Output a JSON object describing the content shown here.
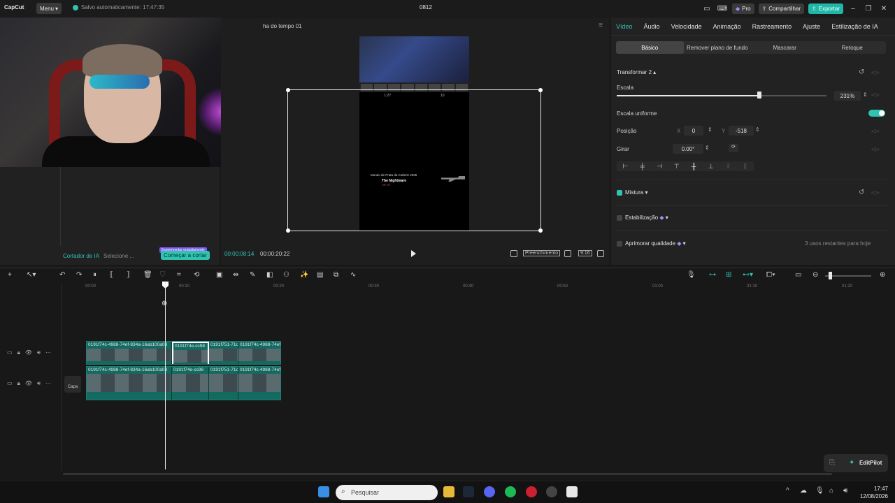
{
  "titlebar": {
    "app_name": "CapCut",
    "menu_label": "Menu",
    "autosave_text": "Salvo automaticamente: 17:47:35",
    "project_name": "0812",
    "pro_label": "Pro",
    "share_label": "Compartilhar",
    "export_label": "Exportar"
  },
  "media": {
    "ai_cutter_label": "Cortador de IA",
    "select_text": "Selecione ...",
    "trial_badge": "Experimentar gratuitamente",
    "start_cut_label": "Começar a cortar"
  },
  "player": {
    "title": "ha do tempo 01",
    "current_time": "00:00:08:14",
    "total_time": "00:00:20:22",
    "fill_label": "Preenchimento",
    "ratio_label": "9:16",
    "hud_timer": "1:27",
    "hud_score": "10",
    "killfeed_name": "Mundo de Prata da Cutlerie 2025",
    "killfeed_tag": "The Nightmare",
    "killfeed_weapon": "AK-47"
  },
  "properties": {
    "tabs": [
      "Vídeo",
      "Áudio",
      "Velocidade",
      "Animação",
      "Rastreamento",
      "Ajuste",
      "Estilização de IA"
    ],
    "active_tab": 0,
    "subtabs": [
      "Básico",
      "Remover plano de fundo",
      "Mascarar",
      "Retoque"
    ],
    "active_subtab": 0,
    "transform_title": "Transformar 2",
    "scale_label": "Escala",
    "scale_value": "231%",
    "scale_fraction": 0.68,
    "uniform_scale_label": "Escala uniforme",
    "uniform_scale_on": true,
    "position_label": "Posição",
    "pos_x_label": "X",
    "pos_x": "0",
    "pos_y_label": "Y",
    "pos_y": "-518",
    "rotate_label": "Girar",
    "rotate_value": "0.00°",
    "blend_label": "Mistura",
    "stabilize_label": "Estabilização",
    "enhance_label": "Aprimorar qualidade",
    "uses_left": "3 usos restantes para hoje"
  },
  "timeline": {
    "ruler_ticks": [
      "00:00",
      "00:10",
      "00:20",
      "00:30",
      "00:40",
      "00:50",
      "01:00",
      "01:10",
      "01:20"
    ],
    "cover_label": "Capa",
    "track1_clips": [
      "0191f74c-4988-74ef-834a-16ab100a03",
      "0191f74e-cc98",
      "0191f751-71c",
      "0191f74c-4988-74ef"
    ],
    "track2_clips": [
      "0191f74c-4988-74ef-834a-16ab100a03",
      "0191f74e-cc98",
      "0191f751-71c",
      "0191f74c-4988-74ef"
    ],
    "editpilot_label": "EditPilot"
  },
  "taskbar": {
    "search_placeholder": "Pesquisar",
    "time": "17:47",
    "date": "12/08/2026"
  },
  "colors": {
    "accent": "#2fc4b2",
    "clip": "#126a60",
    "background": "#181818"
  }
}
